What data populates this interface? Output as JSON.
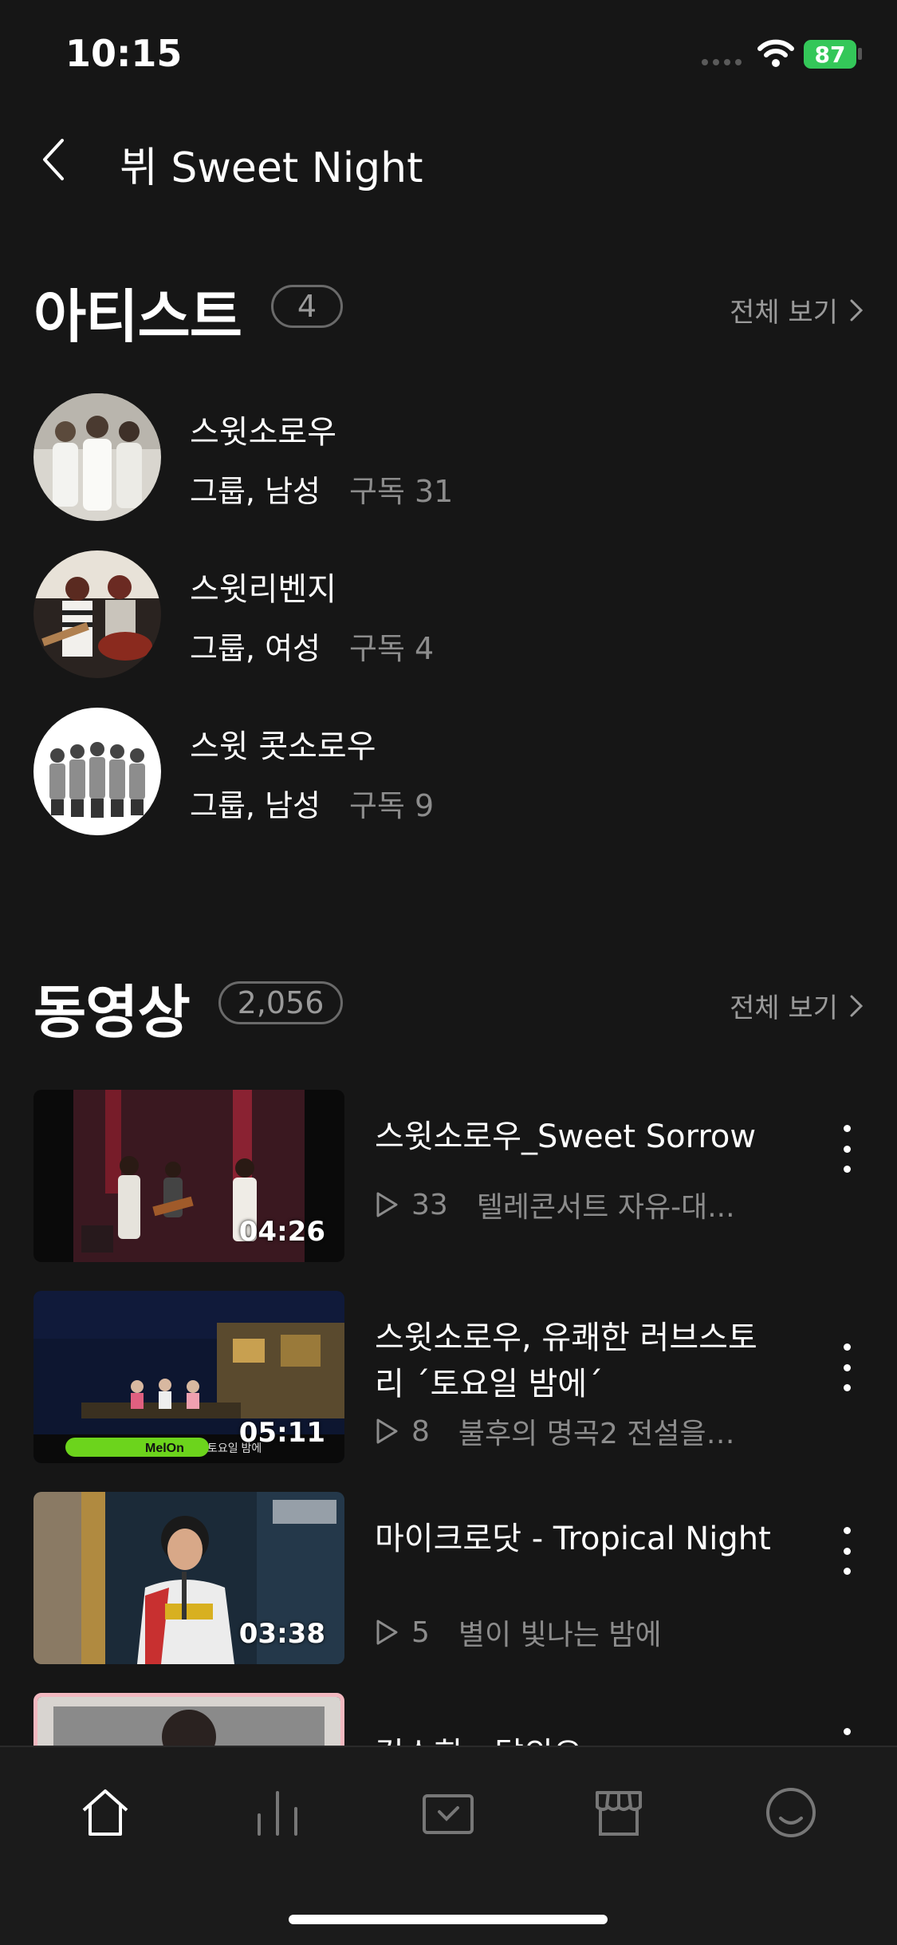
{
  "status_bar": {
    "time": "10:15",
    "battery": "87"
  },
  "header": {
    "title": "뷔 Sweet Night"
  },
  "artists_section": {
    "title": "아티스트",
    "count": "4",
    "see_all": "전체 보기",
    "items": [
      {
        "name": "스윗소로우",
        "meta": "그룹, 남성",
        "subs": "구독 31"
      },
      {
        "name": "스윗리벤지",
        "meta": "그룹, 여성",
        "subs": "구독 4"
      },
      {
        "name": "스윗 콧소로우",
        "meta": "그룹, 남성",
        "subs": "구독 9"
      }
    ]
  },
  "videos_section": {
    "title": "동영상",
    "count": "2,056",
    "see_all": "전체 보기",
    "items": [
      {
        "title": "스윗소로우_Sweet Sorrow",
        "duration": "04:26",
        "plays": "33",
        "desc": "텔레콘서트 자유-대..."
      },
      {
        "title": "스윗소로우, 유쾌한 러브스토리 ´토요일 밤에´",
        "duration": "05:11",
        "plays": "8",
        "desc": "불후의 명곡2 전설을…"
      },
      {
        "title": "마이크로닷 - Tropical Night",
        "duration": "03:38",
        "plays": "5",
        "desc": "별이 빛나는 밤에"
      },
      {
        "title": "김소희 - 달의요",
        "duration": "",
        "plays": "",
        "desc": ""
      }
    ]
  },
  "thumb_overlays": {
    "melon_logo": "MelOn",
    "show_tag": "토요일 밤에"
  },
  "tabs": [
    {
      "name": "home",
      "icon": "home-icon"
    },
    {
      "name": "chart",
      "icon": "chart-icon"
    },
    {
      "name": "library",
      "icon": "library-icon"
    },
    {
      "name": "store",
      "icon": "store-icon"
    },
    {
      "name": "my",
      "icon": "smile-icon"
    }
  ],
  "colors": {
    "background": "#161616",
    "muted": "#8c8c8c",
    "battery": "#34c759"
  }
}
